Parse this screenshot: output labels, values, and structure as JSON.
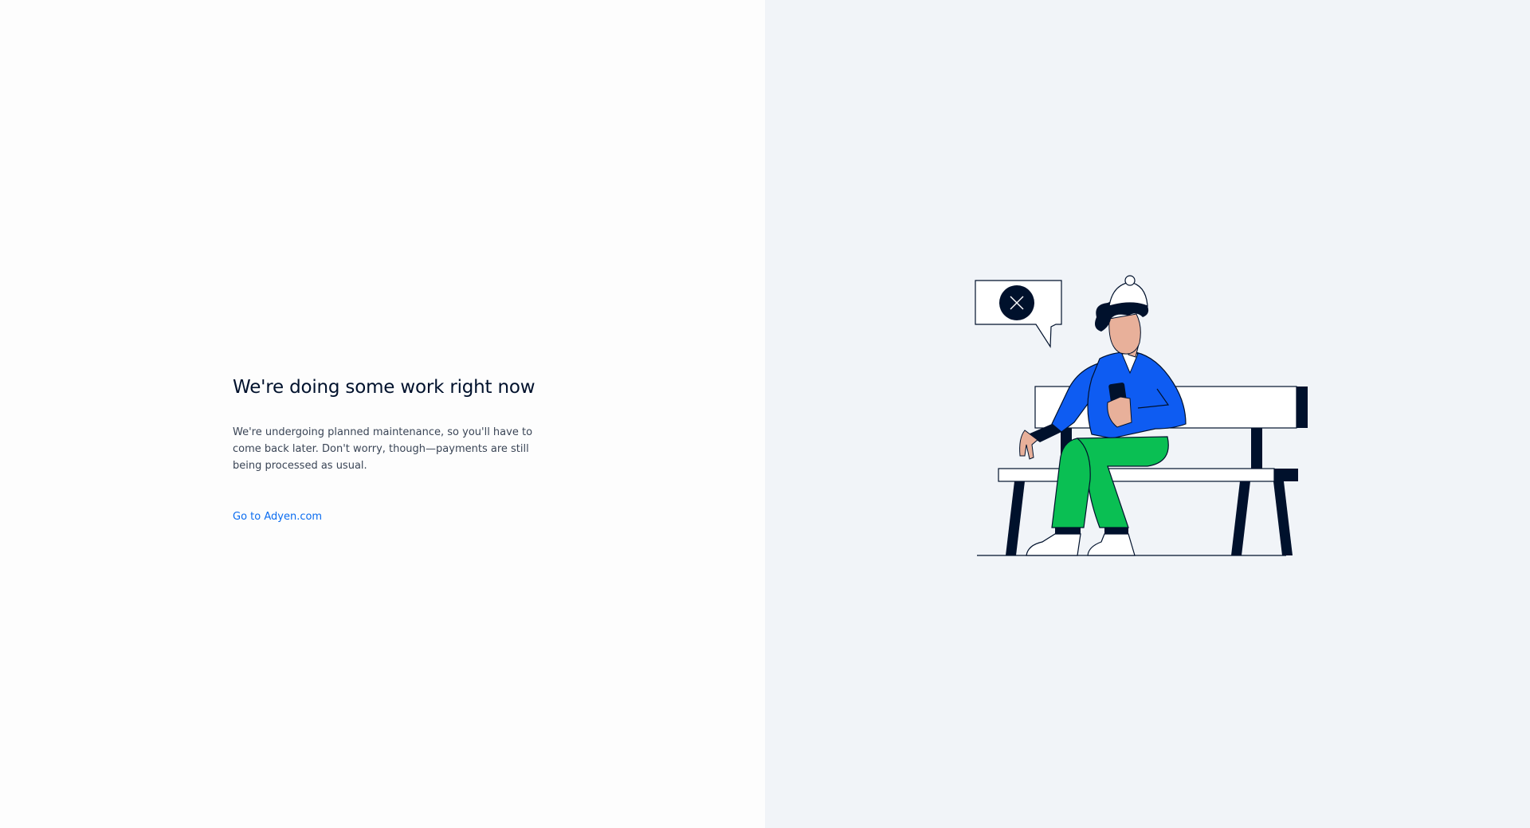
{
  "maintenance": {
    "title": "We're doing some work right now",
    "description": "We're undergoing planned maintenance, so you'll have to come back later. Don't worry, though—payments are still being processed as usual.",
    "link_label": "Go to Adyen.com"
  },
  "illustration": {
    "speech_bubble_icon": "close-icon",
    "colors": {
      "navy": "#00112c",
      "blue": "#0a6cf0",
      "shirt_blue": "#0e5cf2",
      "pants_green": "#0abf53",
      "skin": "#e8b09a",
      "panel_bg": "#f1f4f8"
    }
  }
}
